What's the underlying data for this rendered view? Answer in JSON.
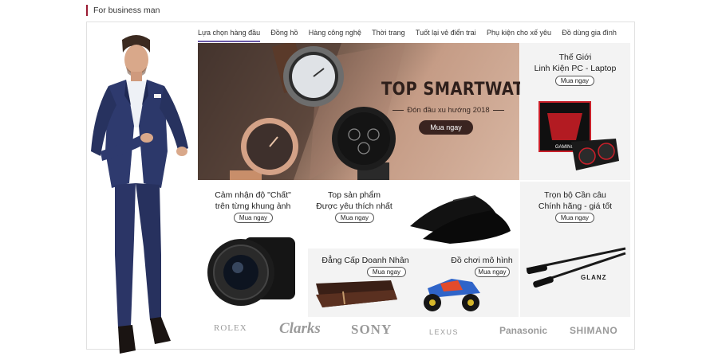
{
  "section": {
    "title": "For business man"
  },
  "tabs": [
    {
      "label": "Lựa chọn hàng đầu",
      "active": true
    },
    {
      "label": "Đồng hồ"
    },
    {
      "label": "Hàng công nghệ"
    },
    {
      "label": "Thời trang"
    },
    {
      "label": "Tuốt lại vẻ điển trai"
    },
    {
      "label": "Phụ kiện cho xế yêu"
    },
    {
      "label": "Đồ dùng gia đình"
    }
  ],
  "hero": {
    "title": "TOP SMARTWATCH",
    "subtitle": "Đón đầu xu hướng 2018",
    "button": "Mua ngay"
  },
  "cards": {
    "pc": {
      "title_line1": "Thế Giới",
      "title_line2": "Linh Kiện PC - Laptop",
      "button": "Mua ngay",
      "product_text": "GAMING"
    },
    "camera": {
      "title_line1": "Cảm nhận độ \"Chất\"",
      "title_line2": "trên từng khung ảnh",
      "button": "Mua ngay"
    },
    "shoes": {
      "title_line1": "Top sản phẩm",
      "title_line2": "Được yêu thích nhất",
      "button": "Mua ngay"
    },
    "fishing": {
      "title_line1": "Trọn bộ Cần câu",
      "title_line2": "Chính hãng - giá tốt",
      "button": "Mua ngay",
      "brand_text": "GLANZ"
    },
    "wallet": {
      "title": "Đẳng Cấp Doanh Nhân",
      "button": "Mua ngay"
    },
    "toys": {
      "title": "Đồ chơi mô hình",
      "button": "Mua ngay"
    }
  },
  "brands": [
    "ROLEX",
    "Clarks",
    "SONY",
    "LEXUS",
    "Panasonic",
    "SHIMANO"
  ],
  "colors": {
    "accent": "#9b1b33",
    "tab_underline": "#6a5aa8",
    "hero_button": "#3a2420"
  }
}
